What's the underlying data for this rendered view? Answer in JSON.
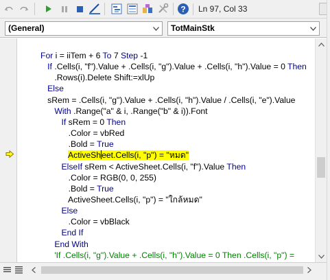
{
  "toolbar": {
    "status": "Ln 97, Col 33",
    "icons": [
      "undo-icon",
      "redo-icon",
      "run-icon",
      "break-icon",
      "reset-icon",
      "design-mode-icon",
      "project-explorer-icon",
      "properties-icon",
      "object-browser-icon",
      "toolbox-icon",
      "help-icon"
    ]
  },
  "dropdowns": {
    "object": "(General)",
    "procedure": "TotMainStk"
  },
  "code": {
    "lines": [
      [
        {
          "t": "For ",
          "c": "kw"
        },
        {
          "t": "i = iiTem + 6 "
        },
        {
          "t": "To ",
          "c": "kw"
        },
        {
          "t": "7 "
        },
        {
          "t": "Step ",
          "c": "kw"
        },
        {
          "t": "-1"
        }
      ],
      [
        {
          "t": "   "
        },
        {
          "t": "If ",
          "c": "kw"
        },
        {
          "t": ".Cells(i, \"f\").Value + .Cells(i, \"g\").Value + .Cells(i, \"h\").Value = 0 "
        },
        {
          "t": "Then",
          "c": "kw"
        }
      ],
      [
        {
          "t": "      .Rows(i).Delete Shift:=xlUp"
        }
      ],
      [
        {
          "t": "   "
        },
        {
          "t": "Else",
          "c": "kw"
        }
      ],
      [
        {
          "t": "   sRem = .Cells(i, \"g\").Value + .Cells(i, \"h\").Value / .Cells(i, \"e\").Value"
        }
      ],
      [
        {
          "t": "      "
        },
        {
          "t": "With ",
          "c": "kw"
        },
        {
          "t": ".Range(\"a\" & i, .Range(\"b\" & i)).Font"
        }
      ],
      [
        {
          "t": "         "
        },
        {
          "t": "If ",
          "c": "kw"
        },
        {
          "t": "sRem = 0 "
        },
        {
          "t": "Then",
          "c": "kw"
        }
      ],
      [
        {
          "t": "            .Color = vbRed"
        }
      ],
      [
        {
          "t": "            .Bold = "
        },
        {
          "t": "True",
          "c": "kw"
        }
      ],
      [
        {
          "t": "            "
        },
        {
          "t": "ActiveSh",
          "c": "hl"
        },
        {
          "cursor": true
        },
        {
          "t": "eet.Cells(i, \"p\") = \"หมด\"",
          "c": "hl"
        }
      ],
      [
        {
          "t": "         "
        },
        {
          "t": "ElseIf ",
          "c": "kw"
        },
        {
          "t": "sRem < ActiveSheet.Cells(i, \"f\").Value "
        },
        {
          "t": "Then",
          "c": "kw"
        }
      ],
      [
        {
          "t": "            .Color = RGB(0, 0, 255)"
        }
      ],
      [
        {
          "t": "            .Bold = "
        },
        {
          "t": "True",
          "c": "kw"
        }
      ],
      [
        {
          "t": "            ActiveSheet.Cells(i, \"p\") = \"ใกล้หมด\""
        }
      ],
      [
        {
          "t": "         "
        },
        {
          "t": "Else",
          "c": "kw"
        }
      ],
      [
        {
          "t": "            .Color = vbBlack"
        }
      ],
      [
        {
          "t": "         "
        },
        {
          "t": "End If",
          "c": "kw"
        }
      ],
      [
        {
          "t": "      "
        },
        {
          "t": "End With",
          "c": "kw"
        }
      ],
      [
        {
          "t": "      'If .Cells(i, \"g\").Value + .Cells(i, \"h\").Value = 0 Then .Cells(i, \"p\") = ",
          "c": "cm"
        }
      ]
    ]
  },
  "colors": {
    "keyword": "#00008b",
    "comment": "#008000",
    "highlight": "#ffff00",
    "current_line_marker": "#ffff00"
  }
}
